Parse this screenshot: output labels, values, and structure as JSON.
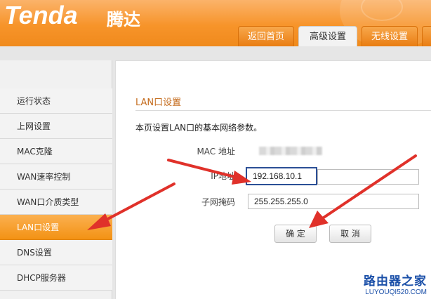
{
  "header": {
    "logo": "Tenda",
    "logo_cn": "腾达",
    "tabs": [
      {
        "label": "返回首页",
        "active": false
      },
      {
        "label": "高级设置",
        "active": true
      },
      {
        "label": "无线设置",
        "active": false
      }
    ]
  },
  "sidebar": {
    "items": [
      {
        "label": "运行状态",
        "active": false
      },
      {
        "label": "上网设置",
        "active": false
      },
      {
        "label": "MAC克隆",
        "active": false
      },
      {
        "label": "WAN速率控制",
        "active": false
      },
      {
        "label": "WAN口介质类型",
        "active": false
      },
      {
        "label": "LAN口设置",
        "active": true
      },
      {
        "label": "DNS设置",
        "active": false
      },
      {
        "label": "DHCP服务器",
        "active": false
      }
    ]
  },
  "main": {
    "section_title": "LAN口设置",
    "description": "本页设置LAN口的基本网络参数。",
    "mac_label": "MAC 地址",
    "ip_label": "IP地址",
    "ip_value": "192.168.10.1",
    "mask_label": "子网掩码",
    "mask_value": "255.255.255.0",
    "ok_button": "确 定",
    "cancel_button": "取 消"
  },
  "watermark": {
    "cn": "路由器之家",
    "en": "LUYOUQI520.COM"
  },
  "colors": {
    "brand_orange": "#f39214",
    "annotation_red": "#e0312a",
    "focus_blue": "#2b4f96"
  }
}
